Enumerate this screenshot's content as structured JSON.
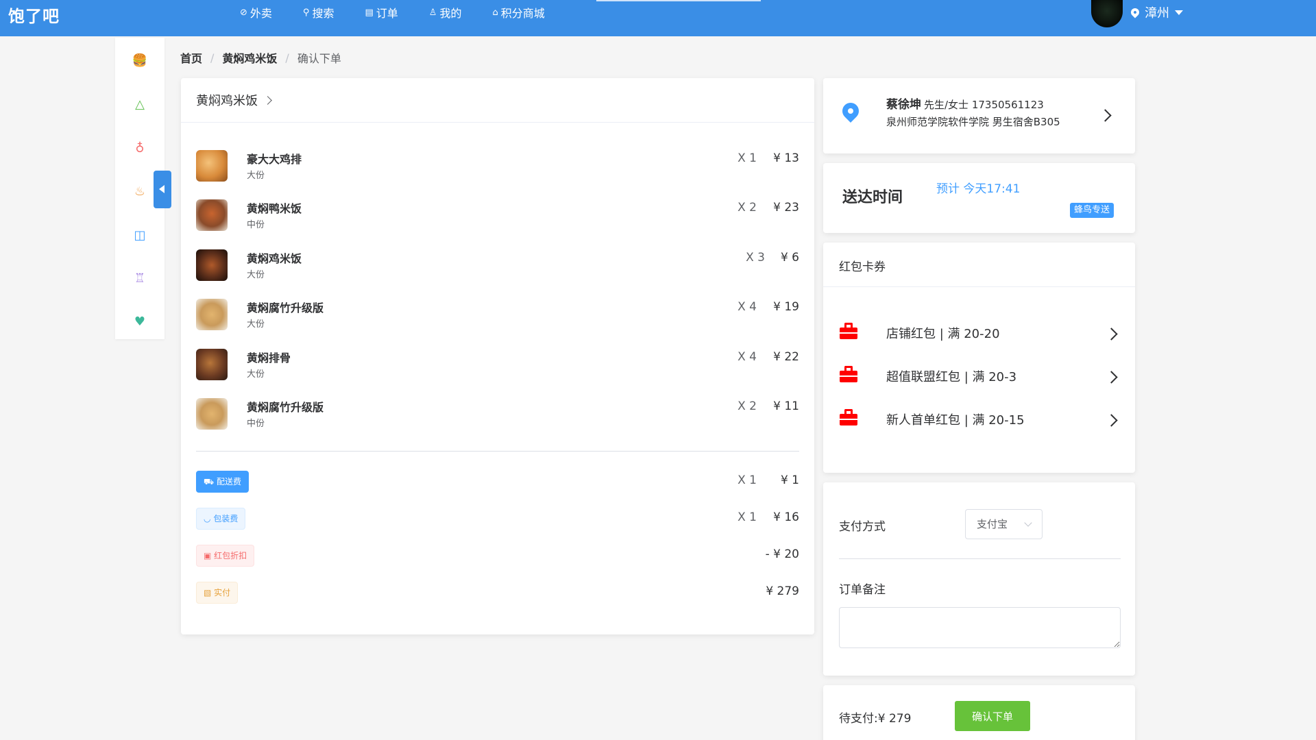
{
  "app": {
    "logo": "饱了吧"
  },
  "nav": {
    "items": [
      {
        "label": "外卖",
        "icon": "compass-icon",
        "glyph": "⊘"
      },
      {
        "label": "搜索",
        "icon": "search-icon",
        "glyph": "⚲"
      },
      {
        "label": "订单",
        "icon": "document-icon",
        "glyph": "▤"
      },
      {
        "label": "我的",
        "icon": "user-icon",
        "glyph": "♙"
      },
      {
        "label": "积分商城",
        "icon": "bag-icon",
        "glyph": "⌂"
      }
    ],
    "location": "漳州"
  },
  "sidebar": {
    "categories": [
      {
        "icon": "burger-icon",
        "glyph": "🍔",
        "color": "#f0a04b"
      },
      {
        "icon": "rice-ball-icon",
        "glyph": "△",
        "color": "#5fbf4f"
      },
      {
        "icon": "fruit-icon",
        "glyph": "♁",
        "color": "#f56c6c"
      },
      {
        "icon": "chef-hat-icon",
        "glyph": "♨",
        "color": "#f0a04b"
      },
      {
        "icon": "basket-icon",
        "glyph": "◫",
        "color": "#409eff"
      },
      {
        "icon": "cake-icon",
        "glyph": "♖",
        "color": "#a07ee0"
      },
      {
        "icon": "drink-icon",
        "glyph": "♥",
        "color": "#3cb89a"
      }
    ]
  },
  "breadcrumb": {
    "home": "首页",
    "shop": "黄焖鸡米饭",
    "current": "确认下单",
    "sep": "/"
  },
  "order": {
    "shop_name": "黄焖鸡米饭",
    "items": [
      {
        "name": "豪大大鸡排",
        "spec": "大份",
        "qty": "X 1",
        "price": "¥ 13",
        "color": "#d88a3a"
      },
      {
        "name": "黄焖鸭米饭",
        "spec": "中份",
        "qty": "X 2",
        "price": "¥ 23",
        "color": "#8a4b2a"
      },
      {
        "name": "黄焖鸡米饭",
        "spec": "大份",
        "qty": "X 3",
        "price": "¥ 6",
        "color": "#5a2d1a"
      },
      {
        "name": "黄焖腐竹升级版",
        "spec": "大份",
        "qty": "X 4",
        "price": "¥ 19",
        "color": "#c99a5b"
      },
      {
        "name": "黄焖排骨",
        "spec": "大份",
        "qty": "X 4",
        "price": "¥ 22",
        "color": "#6b3a22"
      },
      {
        "name": "黄焖腐竹升级版",
        "spec": "中份",
        "qty": "X 2",
        "price": "¥ 11",
        "color": "#c99a5b"
      }
    ],
    "fees": [
      {
        "label": "配送费",
        "icon": "truck-icon",
        "glyph": "⛟",
        "style": "blue",
        "qty": "X 1",
        "price": "¥ 1"
      },
      {
        "label": "包装费",
        "icon": "bowl-icon",
        "glyph": "◡",
        "style": "lightblue",
        "qty": "X 1",
        "price": "¥ 16"
      },
      {
        "label": "红包折扣",
        "icon": "lock-icon",
        "glyph": "▣",
        "style": "lightred",
        "qty": "",
        "price": "- ¥ 20"
      },
      {
        "label": "实付",
        "icon": "wallet-icon",
        "glyph": "▧",
        "style": "lightorange",
        "qty": "",
        "price": "¥ 279"
      }
    ]
  },
  "address": {
    "name": "蔡徐坤",
    "title_phone": "先生/女士 17350561123",
    "line": "泉州师范学院软件学院 男生宿舍B305"
  },
  "delivery": {
    "label": "送达时间",
    "estimate": "预计 今天17:41",
    "badge": "蜂鸟专送"
  },
  "coupons": {
    "title": "红包卡券",
    "items": [
      {
        "label": "店铺红包 | 满 20-20"
      },
      {
        "label": "超值联盟红包 | 满 20-3"
      },
      {
        "label": "新人首单红包 | 满 20-15"
      }
    ]
  },
  "payment": {
    "label": "支付方式",
    "selected": "支付宝",
    "note_label": "订单备注",
    "note_value": ""
  },
  "submit": {
    "due_label": "待支付:",
    "due_value": "¥ 279",
    "button": "确认下单"
  },
  "colors": {
    "primary": "#3a8ee6",
    "accent": "#409eff",
    "success": "#67c23a",
    "coupon": "#ff0000"
  }
}
